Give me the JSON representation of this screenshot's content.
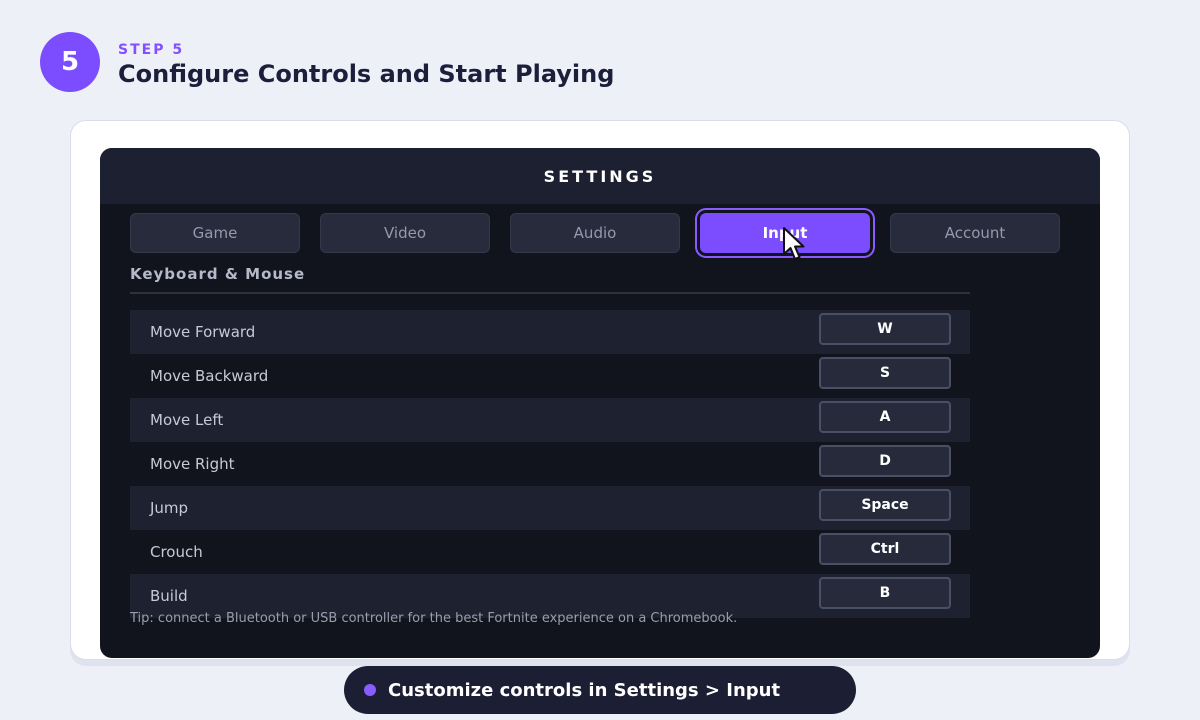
{
  "step": {
    "number": "5",
    "label": "STEP 5",
    "title": "Configure Controls and Start Playing"
  },
  "settings": {
    "title": "SETTINGS",
    "tabs": [
      {
        "label": "Game"
      },
      {
        "label": "Video"
      },
      {
        "label": "Audio"
      },
      {
        "label": "Input",
        "active": true
      },
      {
        "label": "Account"
      }
    ],
    "section_title": "Keyboard & Mouse",
    "bindings": [
      {
        "action": "Move Forward",
        "key": "W"
      },
      {
        "action": "Move Backward",
        "key": "S"
      },
      {
        "action": "Move Left",
        "key": "A"
      },
      {
        "action": "Move Right",
        "key": "D"
      },
      {
        "action": "Jump",
        "key": "Space"
      },
      {
        "action": "Crouch",
        "key": "Ctrl"
      },
      {
        "action": "Build",
        "key": "B"
      }
    ],
    "tip": "Tip: connect a Bluetooth or USB controller for the best Fortnite experience on a Chromebook."
  },
  "caption": {
    "text": "Customize controls in Settings > Input"
  },
  "colors": {
    "accent": "#7c4dff",
    "panel_bg": "#12141d",
    "page_bg": "#eef0f8"
  },
  "icons": {
    "cursor": "mouse-pointer-icon"
  }
}
